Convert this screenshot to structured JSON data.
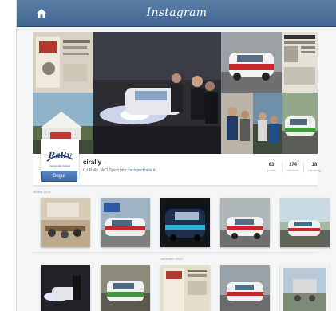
{
  "app": {
    "title": "Instagram"
  },
  "icons": {
    "home": "home-icon"
  },
  "profile": {
    "username": "cirally",
    "name_badge": "·",
    "bio_prefix": "C.I.Rally · ACI Sport",
    "bio_link": "http://acisportitalia.it",
    "follow_label": "Segui",
    "avatar_text": "Rally",
    "avatar_subtext": "Campionato Italiano"
  },
  "stats": [
    {
      "value": "63",
      "label": "posts"
    },
    {
      "value": "174",
      "label": "followers"
    },
    {
      "value": "18",
      "label": "following"
    }
  ],
  "months": {
    "first": "ottobre 2014",
    "second": "settembre 2014"
  },
  "colors": {
    "nav": "#4a6f9a",
    "accent": "#3f729b",
    "button": "#4a7bb8"
  }
}
